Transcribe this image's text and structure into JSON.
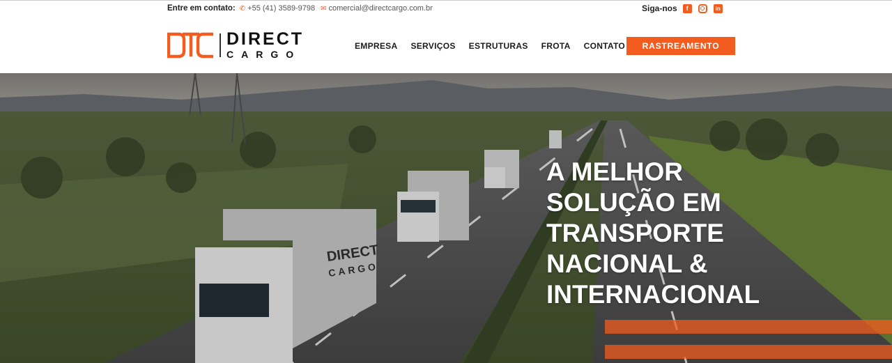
{
  "topbar": {
    "contact_label": "Entre em contato:",
    "phone": "+55 (41) 3589-9798",
    "email": "comercial@directcargo.com.br",
    "social_label": "Siga-nos",
    "social_icons": [
      "facebook-icon",
      "instagram-icon",
      "linkedin-icon"
    ]
  },
  "logo": {
    "line1": "DIRECT",
    "line2": "CARGO"
  },
  "nav": {
    "items": [
      {
        "label": "EMPRESA"
      },
      {
        "label": "SERVIÇOS"
      },
      {
        "label": "ESTRUTURAS"
      },
      {
        "label": "FROTA"
      },
      {
        "label": "CONTATO"
      }
    ],
    "cta_label": "RASTREAMENTO"
  },
  "hero": {
    "headline_lines": [
      "A MELHOR",
      "SOLUÇÃO EM",
      "TRANSPORTE",
      "NACIONAL &",
      "INTERNACIONAL"
    ]
  },
  "truck_branding": {
    "line1": "DIRECT",
    "line2": "CARGO"
  },
  "colors": {
    "accent": "#f25c1f",
    "text": "#1b1b1b",
    "background": "#ffffff"
  }
}
